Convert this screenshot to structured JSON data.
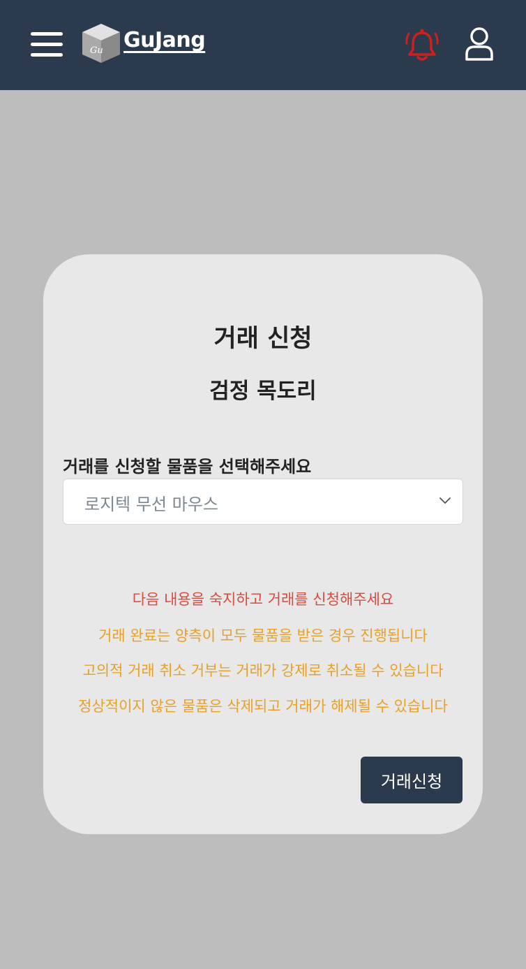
{
  "header": {
    "logo_text": "GuJang",
    "logo_cube_label": "Gu",
    "icons": {
      "menu": "hamburger-menu-icon",
      "notification": "bell-ringing-icon",
      "profile": "user-icon"
    },
    "colors": {
      "background": "#2b3a4c",
      "bell": "#d0201c"
    }
  },
  "card": {
    "title": "거래 신청",
    "item_name": "검정 목도리",
    "select_label": "거래를 신청할 물품을 선택해주세요",
    "select_value": "로지텍 무선 마우스",
    "notice_head": "다음 내용을 숙지하고 거래를 신청해주세요",
    "notices": [
      "거래 완료는 양측이 모두 물품을 받은 경우 진행됩니다",
      "고의적 거래 취소 거부는 거래가 강제로 취소될 수 있습니다",
      "정상적이지 않은 물품은 삭제되고 거래가 해제될 수 있습니다"
    ],
    "submit_label": "거래신청",
    "colors": {
      "notice_head": "#d84b3f",
      "notice": "#e8a025",
      "button": "#2b3a4c"
    }
  }
}
